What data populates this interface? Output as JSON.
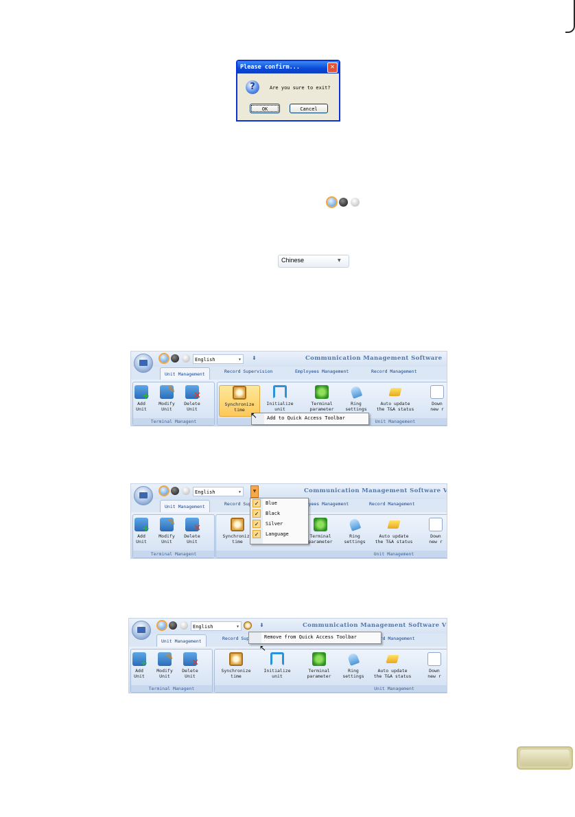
{
  "dialog": {
    "title": "Please confirm...",
    "message": "Are you sure to exit?",
    "ok_label": "OK",
    "cancel_label": "Cancel"
  },
  "language_selector": {
    "value": "Chinese"
  },
  "ribbon": {
    "language": "English",
    "title_full": "Communication Management Software V",
    "title_short": "Communication Management Software",
    "tabs": [
      "Unit Management",
      "Record Supervision",
      "Employees Management",
      "Record Management"
    ],
    "terminal_group": {
      "caption": "Terminal Managent",
      "buttons": [
        "Add\nUnit",
        "Modify\nUnit",
        "Delete\nUnit"
      ]
    },
    "unit_group": {
      "caption": "Unit Management",
      "buttons": [
        "Synchronize\ntime",
        "Initialize\nunit",
        "Terminal\nparameter",
        "Ring\nsettings",
        "Auto update\nthe T&A status",
        "Down\nnew r"
      ]
    }
  },
  "screenshot1": {
    "context_menu": "Add to Quick Access Toolbar"
  },
  "screenshot2": {
    "menu_items": [
      "Blue",
      "Black",
      "Silver",
      "Language"
    ]
  },
  "screenshot3": {
    "context_menu": "Remove from Quick Access Toolbar"
  },
  "colors": {
    "dialog_title": "#0a48d8",
    "ribbon_title": "#5276a8",
    "highlight": "#fcc85a",
    "page_tab": "#d9d3a6"
  }
}
